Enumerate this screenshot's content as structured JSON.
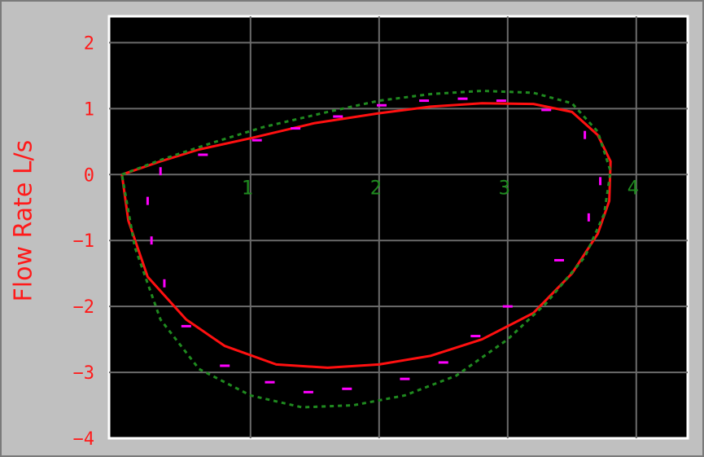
{
  "chart_data": {
    "type": "line",
    "title": "",
    "xlabel": "",
    "ylabel": "Flow Rate L/s",
    "xlim": [
      -0.1,
      4.4
    ],
    "ylim": [
      -4,
      2.4
    ],
    "x_ticks": [
      "1",
      "2",
      "3",
      "4"
    ],
    "y_ticks": [
      "2",
      "1",
      "0",
      "−1",
      "−2",
      "−3",
      "−4"
    ],
    "grid": true,
    "legend": "none",
    "colors": {
      "background": "#000000",
      "grid": "#6b6b6b",
      "measured": "#ff1010",
      "predicted": "#1f8a1f",
      "samples": "#ff00ff",
      "axis_text": "#ff1a1a",
      "x_tick_text": "#1f8a1f",
      "panel": "#c0c0c0"
    },
    "series": [
      {
        "style": "solid",
        "color": "#ff1010",
        "x": [
          0.0,
          0.3,
          0.6,
          1.0,
          1.5,
          2.0,
          2.4,
          2.8,
          3.2,
          3.5,
          3.7,
          3.8,
          3.79,
          3.7,
          3.5,
          3.2,
          2.8,
          2.4,
          2.0,
          1.6,
          1.2,
          0.8,
          0.5,
          0.2,
          0.05,
          0.0
        ],
        "y": [
          0.0,
          0.2,
          0.38,
          0.55,
          0.78,
          0.93,
          1.03,
          1.08,
          1.07,
          0.95,
          0.6,
          0.2,
          -0.4,
          -0.9,
          -1.5,
          -2.1,
          -2.5,
          -2.75,
          -2.88,
          -2.93,
          -2.88,
          -2.6,
          -2.2,
          -1.55,
          -0.7,
          0.0
        ]
      },
      {
        "style": "dashed",
        "color": "#1f8a1f",
        "x": [
          0.0,
          0.3,
          0.7,
          1.1,
          1.6,
          2.0,
          2.4,
          2.8,
          3.2,
          3.5,
          3.7,
          3.8,
          3.75,
          3.6,
          3.3,
          3.0,
          2.6,
          2.2,
          1.8,
          1.4,
          1.0,
          0.6,
          0.3,
          0.1,
          0.0
        ],
        "y": [
          0.0,
          0.22,
          0.48,
          0.72,
          0.95,
          1.12,
          1.22,
          1.27,
          1.24,
          1.08,
          0.65,
          0.05,
          -0.6,
          -1.25,
          -1.95,
          -2.5,
          -3.05,
          -3.35,
          -3.5,
          -3.53,
          -3.35,
          -2.95,
          -2.2,
          -1.1,
          0.0
        ]
      }
    ],
    "samples": {
      "color": "#ff00ff",
      "points": [
        [
          0.3,
          0.05
        ],
        [
          0.63,
          0.3
        ],
        [
          1.05,
          0.52
        ],
        [
          1.35,
          0.7
        ],
        [
          1.68,
          0.88
        ],
        [
          2.02,
          1.05
        ],
        [
          2.35,
          1.12
        ],
        [
          2.65,
          1.15
        ],
        [
          2.95,
          1.12
        ],
        [
          3.3,
          0.98
        ],
        [
          3.6,
          0.6
        ],
        [
          3.72,
          -0.1
        ],
        [
          3.63,
          -0.65
        ],
        [
          3.4,
          -1.3
        ],
        [
          3.0,
          -2.0
        ],
        [
          2.75,
          -2.45
        ],
        [
          2.5,
          -2.85
        ],
        [
          2.2,
          -3.1
        ],
        [
          1.75,
          -3.25
        ],
        [
          1.45,
          -3.3
        ],
        [
          1.15,
          -3.15
        ],
        [
          0.8,
          -2.9
        ],
        [
          0.5,
          -2.3
        ],
        [
          0.33,
          -1.65
        ],
        [
          0.23,
          -1.0
        ],
        [
          0.2,
          -0.4
        ]
      ]
    }
  }
}
